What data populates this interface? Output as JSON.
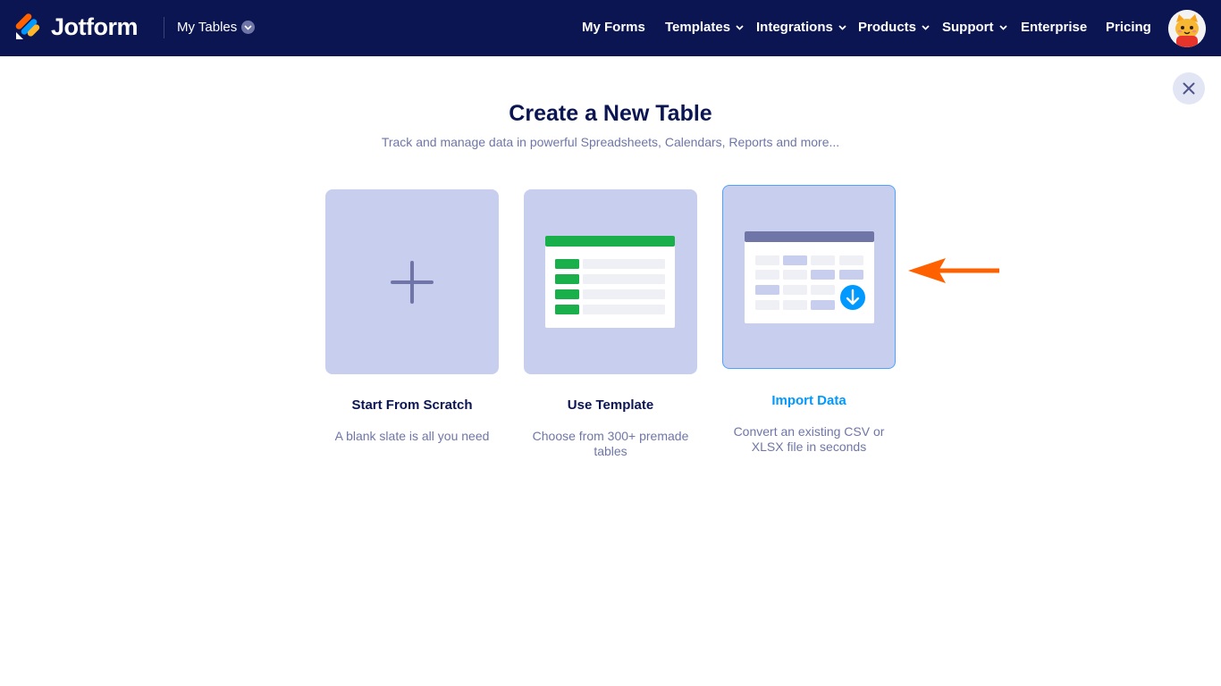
{
  "header": {
    "brand": "Jotform",
    "section": "My Tables",
    "nav": [
      {
        "label": "My Forms",
        "dropdown": false
      },
      {
        "label": "Templates",
        "dropdown": true
      },
      {
        "label": "Integrations",
        "dropdown": true
      },
      {
        "label": "Products",
        "dropdown": true
      },
      {
        "label": "Support",
        "dropdown": true
      },
      {
        "label": "Enterprise",
        "dropdown": false
      },
      {
        "label": "Pricing",
        "dropdown": false
      }
    ]
  },
  "main": {
    "title": "Create a New Table",
    "subtitle": "Track and manage data in powerful Spreadsheets, Calendars, Reports and more...",
    "options": [
      {
        "title": "Start From Scratch",
        "description": "A blank slate is all you need"
      },
      {
        "title": "Use Template",
        "description_line1": "Choose from 300+ premade",
        "description_line2": "tables"
      },
      {
        "title": "Import Data",
        "description_line1": "Convert an existing CSV or",
        "description_line2": "XLSX file in seconds",
        "selected": true
      }
    ]
  },
  "colors": {
    "header_bg": "#0a1551",
    "card_bg": "#c8ceed",
    "accent_blue": "#0099ff",
    "template_green": "#19b04b",
    "annotation_arrow": "#ff6100"
  }
}
